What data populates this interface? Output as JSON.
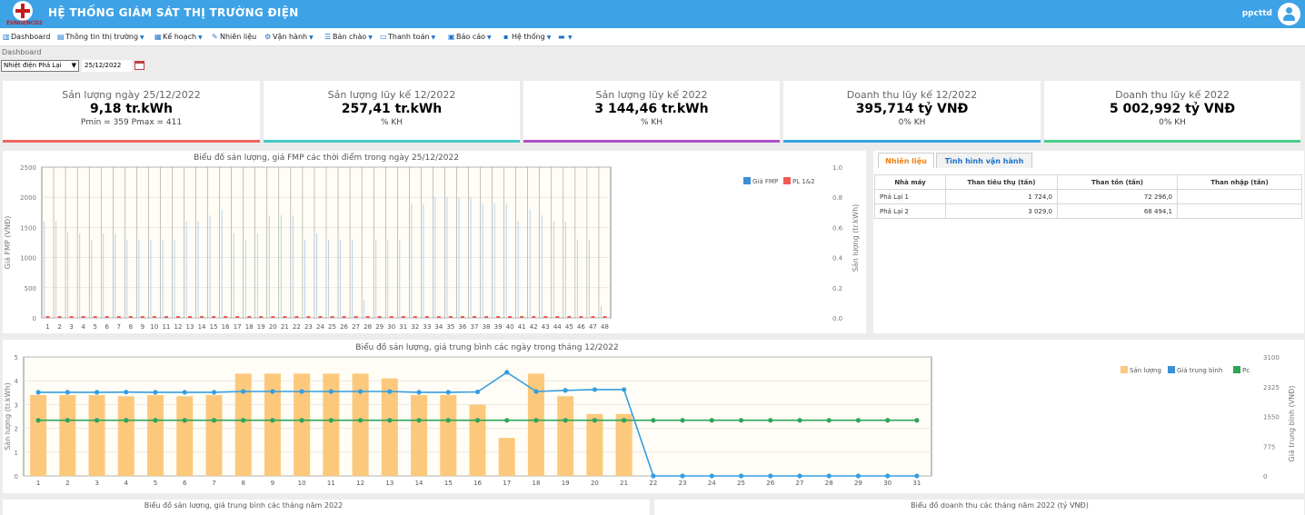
{
  "header": {
    "logo_text": "EVNGENCO2",
    "title": "HỆ THỐNG GIÁM SÁT THỊ TRƯỜNG ĐIỆN",
    "user": "ppcttd"
  },
  "menu": [
    {
      "icon": "chart-icon",
      "glyph": "▥",
      "label": "Dashboard",
      "caret": false
    },
    {
      "icon": "table-icon",
      "glyph": "▤",
      "label": "Thông tin thị trường",
      "caret": true
    },
    {
      "icon": "calendar-icon",
      "glyph": "▦",
      "label": "Kế hoạch",
      "caret": true
    },
    {
      "icon": "fuel-icon",
      "glyph": "✎",
      "label": "Nhiên liệu",
      "caret": false
    },
    {
      "icon": "gears-icon",
      "glyph": "⚙",
      "label": "Vận hành",
      "caret": true
    },
    {
      "icon": "list-icon",
      "glyph": "☰",
      "label": "Bản chào",
      "caret": true
    },
    {
      "icon": "card-icon",
      "glyph": "▭",
      "label": "Thanh toán",
      "caret": true
    },
    {
      "icon": "report-icon",
      "glyph": "▣",
      "label": "Báo cáo",
      "caret": true
    },
    {
      "icon": "system-icon",
      "glyph": "▪",
      "label": "Hệ thống",
      "caret": true
    },
    {
      "icon": "book-icon",
      "glyph": "▬",
      "label": "",
      "caret": true
    }
  ],
  "breadcrumb": "Dashboard",
  "filters": {
    "plant": "Nhiệt điện Phả Lại",
    "date": "25/12/2022"
  },
  "colors": {
    "red": "#f2665e",
    "teal": "#47c9c3",
    "purple": "#ad4fc3",
    "blue": "#35a4e6",
    "green": "#4ccf8a",
    "bar": "#fcc97c",
    "line_blue": "#359ee0",
    "line_green": "#2ea55b"
  },
  "kpis": [
    {
      "title": "Sản lượng ngày 25/12/2022",
      "value": "9,18 tr.kWh",
      "sub": "Pmin = 359 Pmax = 411",
      "color": "#f2665e"
    },
    {
      "title": "Sản lượng lũy kế 12/2022",
      "value": "257,41 tr.kWh",
      "sub": "% KH",
      "color": "#47c9c3"
    },
    {
      "title": "Sản lượng lũy kế 2022",
      "value": "3 144,46 tr.kWh",
      "sub": "% KH",
      "color": "#ad4fc3"
    },
    {
      "title": "Doanh thu lũy kế 12/2022",
      "value": "395,714 tỷ VNĐ",
      "sub": "0% KH",
      "color": "#35a4e6"
    },
    {
      "title": "Doanh thu lũy kế 2022",
      "value": "5 002,992 tỷ VNĐ",
      "sub": "0% KH",
      "color": "#4ccf8a"
    }
  ],
  "fuel": {
    "tabs": [
      "Nhiên liệu",
      "Tình hình vận hành"
    ],
    "columns": [
      "Nhà máy",
      "Than tiêu thụ (tấn)",
      "Than tồn (tấn)",
      "Than nhập (tấn)"
    ],
    "rows": [
      [
        "Phả Lại 1",
        "1 724,0",
        "72 296,0",
        ""
      ],
      [
        "Phả Lại 2",
        "3 029,0",
        "68 494,1",
        ""
      ]
    ]
  },
  "chart_data": [
    {
      "type": "bar",
      "title": "Biểu đồ sản lượng, giá FMP các thời điểm trong ngày 25/12/2022",
      "ylabel": "Giá FMP (VNĐ)",
      "y2label": "Sản lượng (tr.kWh)",
      "ylim": [
        0,
        2500
      ],
      "y2lim": [
        0,
        1.0
      ],
      "yticks": [
        "0",
        "500",
        "1000",
        "1500",
        "2000",
        "2500"
      ],
      "y2ticks": [
        "0.0",
        "0.2",
        "0.4",
        "0.6",
        "0.8",
        "1.0"
      ],
      "categories": [
        "1",
        "2",
        "3",
        "4",
        "5",
        "6",
        "7",
        "8",
        "9",
        "10",
        "11",
        "12",
        "13",
        "14",
        "15",
        "16",
        "17",
        "18",
        "19",
        "20",
        "21",
        "22",
        "23",
        "24",
        "25",
        "26",
        "27",
        "28",
        "29",
        "30",
        "31",
        "32",
        "33",
        "34",
        "35",
        "36",
        "37",
        "38",
        "39",
        "40",
        "41",
        "42",
        "43",
        "44",
        "45",
        "46",
        "47",
        "48"
      ],
      "series": [
        {
          "name": "Giá FMP",
          "values": [
            1600,
            1600,
            1420,
            1400,
            1300,
            1400,
            1400,
            1300,
            1300,
            1300,
            1300,
            1300,
            1600,
            1600,
            1700,
            1800,
            1400,
            1300,
            1400,
            1700,
            1700,
            1700,
            1300,
            1400,
            1300,
            1300,
            1300,
            300,
            1300,
            1300,
            1300,
            1900,
            1900,
            2000,
            2000,
            2000,
            2000,
            1900,
            1900,
            1900,
            1600,
            1800,
            1700,
            1600,
            1600,
            1300,
            1300,
            200
          ]
        },
        {
          "name": "PL 1&2",
          "values": [
            0.01,
            0.01,
            0.01,
            0.01,
            0.01,
            0.01,
            0.01,
            0.01,
            0.01,
            0.01,
            0.01,
            0.01,
            0.01,
            0.01,
            0.01,
            0.01,
            0.01,
            0.01,
            0.01,
            0.01,
            0.01,
            0.01,
            0.01,
            0.01,
            0.01,
            0.01,
            0.01,
            0.01,
            0.01,
            0.01,
            0.01,
            0.01,
            0.01,
            0.01,
            0.01,
            0.01,
            0.01,
            0.01,
            0.01,
            0.01,
            0.01,
            0.01,
            0.01,
            0.01,
            0.01,
            0.01,
            0.01,
            0.01
          ]
        }
      ],
      "legend": "top-right",
      "grid": true
    },
    {
      "type": "bar",
      "title": "Biểu đồ sản lượng, giá trung bình các ngày trong tháng 12/2022",
      "ylabel": "Sản lượng (tr.kWh)",
      "y2label": "Giá trung bình (VNĐ)",
      "ylim": [
        0,
        5
      ],
      "y2lim": [
        0,
        3100
      ],
      "yticks": [
        "0",
        "1",
        "2",
        "3",
        "4",
        "5"
      ],
      "y2ticks": [
        "0",
        "775",
        "1550",
        "2325",
        "3100"
      ],
      "categories": [
        "1",
        "2",
        "3",
        "4",
        "5",
        "6",
        "7",
        "8",
        "9",
        "10",
        "11",
        "12",
        "13",
        "14",
        "15",
        "16",
        "17",
        "18",
        "19",
        "20",
        "21",
        "22",
        "23",
        "24",
        "25",
        "26",
        "27",
        "28",
        "29",
        "30",
        "31"
      ],
      "series": [
        {
          "name": "Sản lượng",
          "kind": "bar",
          "values": [
            3.4,
            3.4,
            3.4,
            3.35,
            3.4,
            3.35,
            3.4,
            4.3,
            4.3,
            4.3,
            4.3,
            4.3,
            4.1,
            3.4,
            3.4,
            3.0,
            1.6,
            4.3,
            3.35,
            2.6,
            2.6,
            null,
            null,
            null,
            null,
            null,
            null,
            null,
            null,
            null,
            null
          ]
        },
        {
          "name": "Giá trung bình",
          "kind": "line",
          "axis": "right",
          "values": [
            2180,
            2180,
            2180,
            2185,
            2180,
            2180,
            2180,
            2200,
            2200,
            2200,
            2200,
            2200,
            2200,
            2180,
            2180,
            2190,
            2700,
            2200,
            2230,
            2250,
            2250,
            0,
            0,
            0,
            0,
            0,
            0,
            0,
            0,
            0,
            0
          ]
        },
        {
          "name": "Pc",
          "kind": "line",
          "axis": "right",
          "values": [
            1450,
            1450,
            1450,
            1450,
            1450,
            1450,
            1450,
            1450,
            1450,
            1450,
            1450,
            1450,
            1450,
            1450,
            1450,
            1450,
            1450,
            1450,
            1450,
            1450,
            1450,
            1450,
            1450,
            1450,
            1450,
            1450,
            1450,
            1450,
            1450,
            1450,
            1450
          ]
        }
      ],
      "legend": "top-right",
      "grid": true
    }
  ],
  "bottom_titles": [
    "Biểu đồ sản lượng, giá trung bình các tháng năm 2022",
    "Biểu đồ doanh thu các tháng năm 2022 (tỷ VNĐ)"
  ]
}
